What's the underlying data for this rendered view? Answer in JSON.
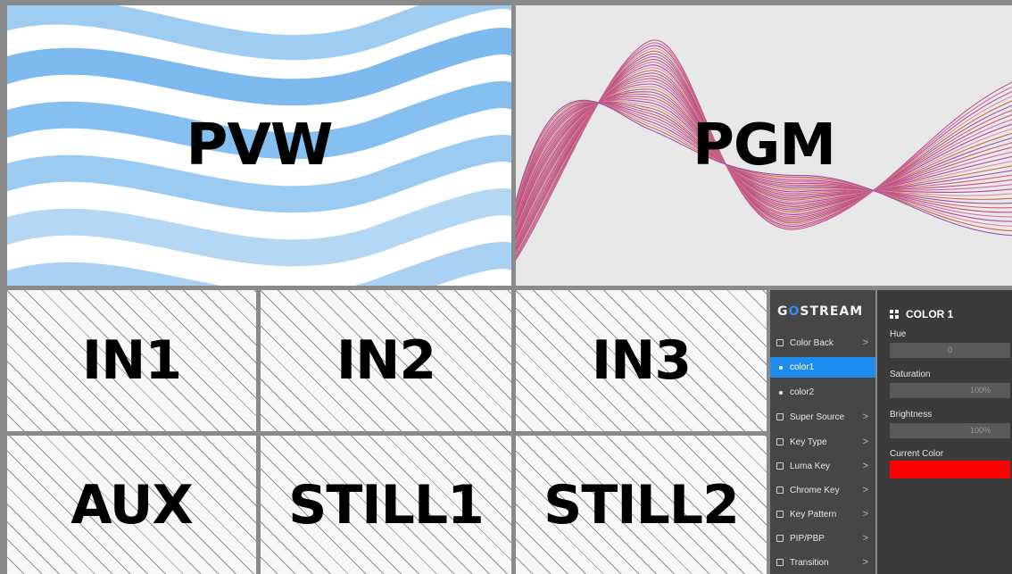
{
  "views": {
    "pvw": "PVW",
    "pgm": "PGM",
    "in1": "IN1",
    "in2": "IN2",
    "in3": "IN3",
    "aux": "AUX",
    "still1": "STILL1",
    "still2": "STILL2"
  },
  "menu": {
    "logo_pre": "G",
    "logo_o": "O",
    "logo_post": "STREAM",
    "items": [
      {
        "label": "Color Back",
        "icon": "square-icon",
        "chevron": ">"
      },
      {
        "label": "color1",
        "icon": "dot-icon",
        "chevron": ""
      },
      {
        "label": "color2",
        "icon": "dot-icon",
        "chevron": ""
      },
      {
        "label": "Super Source",
        "icon": "square-icon",
        "chevron": ">"
      },
      {
        "label": "Key Type",
        "icon": "square-icon",
        "chevron": ">"
      },
      {
        "label": "Luma Key",
        "icon": "square-icon",
        "chevron": ">"
      },
      {
        "label": "Chrome Key",
        "icon": "square-icon",
        "chevron": ">"
      },
      {
        "label": "Key Pattern",
        "icon": "square-icon",
        "chevron": ">"
      },
      {
        "label": "PIP/PBP",
        "icon": "square-icon",
        "chevron": ">"
      },
      {
        "label": "Transition",
        "icon": "square-icon",
        "chevron": ">"
      }
    ]
  },
  "settings": {
    "title": "COLOR 1",
    "hue_label": "Hue",
    "hue_value": "0",
    "saturation_label": "Saturation",
    "saturation_value": "100%",
    "brightness_label": "Brightness",
    "brightness_value": "100%",
    "current_color_label": "Current Color",
    "current_color": "#ff0000"
  },
  "colors": {
    "accent": "#1f8cf0",
    "panel_bg": "#3b3b3b",
    "menu_bg": "#464646"
  }
}
